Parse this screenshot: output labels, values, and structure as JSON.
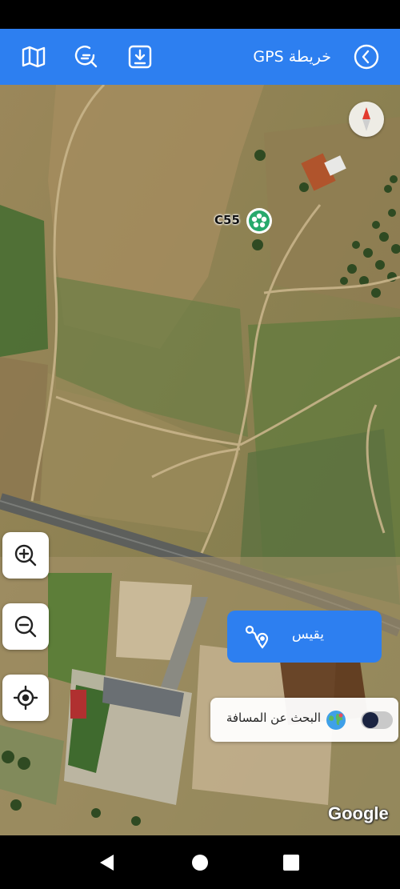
{
  "app_bar": {
    "title": "خريطة GPS",
    "back_icon": "chevron-left-circle-icon",
    "map_icon": "folded-map-icon",
    "search_icon": "magnifier-icon",
    "download_icon": "download-tray-icon",
    "background": "#2d7ff0"
  },
  "map": {
    "marker_label": "C55",
    "marker_icon": "flower-pin-icon",
    "compass_icon": "compass-icon",
    "attribution": "Google",
    "zoom_in_icon": "zoom-in-icon",
    "zoom_out_icon": "zoom-out-icon",
    "locate_icon": "my-location-icon"
  },
  "measure": {
    "label": "يقيس",
    "icon": "route-pin-icon"
  },
  "distance_search": {
    "label": "البحث عن المسافة",
    "icon": "globe-icon",
    "toggle_on": false
  },
  "nav": {
    "back_icon": "triangle-back-icon",
    "home_icon": "circle-home-icon",
    "recents_icon": "square-recents-icon"
  }
}
